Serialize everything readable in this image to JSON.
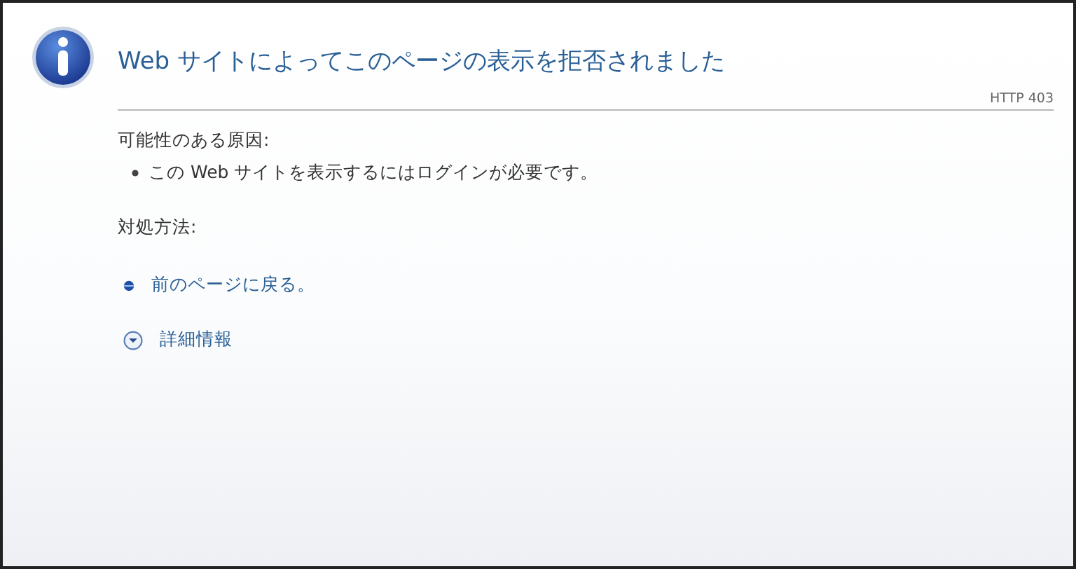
{
  "title": "Web サイトによってこのページの表示を拒否されました",
  "status_code": "HTTP 403",
  "causes": {
    "heading": "可能性のある原因:",
    "items": [
      "この Web サイトを表示するにはログインが必要です。"
    ]
  },
  "remedies": {
    "heading": "対処方法:",
    "links": [
      {
        "kind": "bullet",
        "label": "前のページに戻る。"
      }
    ]
  },
  "details": {
    "label": "詳細情報",
    "expanded": false
  }
}
